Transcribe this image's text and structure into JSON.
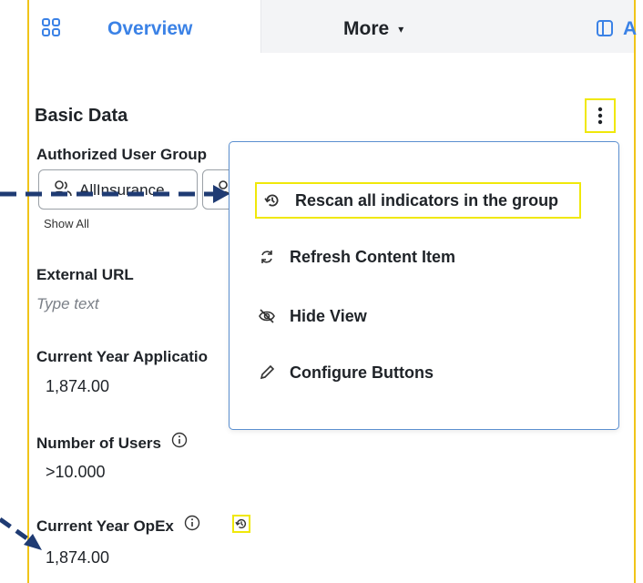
{
  "tabs": {
    "overview_label": "Overview",
    "more_label": "More",
    "more_caret": "▾",
    "a_label": "A"
  },
  "section": {
    "title": "Basic Data"
  },
  "fields": {
    "authorized_group_label": "Authorized User Group",
    "chip_label": "AllInsurance",
    "show_all": "Show All",
    "external_url_label": "External URL",
    "external_url_placeholder": "Type text",
    "current_year_app_label": "Current Year Applicatio",
    "current_year_app_value": "1,874.00",
    "number_users_label": "Number of Users",
    "number_users_value": ">10.000",
    "current_year_opex_label": "Current Year OpEx",
    "current_year_opex_value": "1,874.00"
  },
  "menu": {
    "items": [
      {
        "label": "Rescan all indicators in the group",
        "icon": "rescan-icon"
      },
      {
        "label": "Refresh Content Item",
        "icon": "refresh-icon"
      },
      {
        "label": "Hide View",
        "icon": "eye-off-icon"
      },
      {
        "label": "Configure Buttons",
        "icon": "pencil-icon"
      }
    ]
  },
  "colors": {
    "accent": "#3b82e6",
    "highlight": "#f0e80a",
    "panel_border": "#f0c419",
    "arrow": "#1f3b73"
  }
}
